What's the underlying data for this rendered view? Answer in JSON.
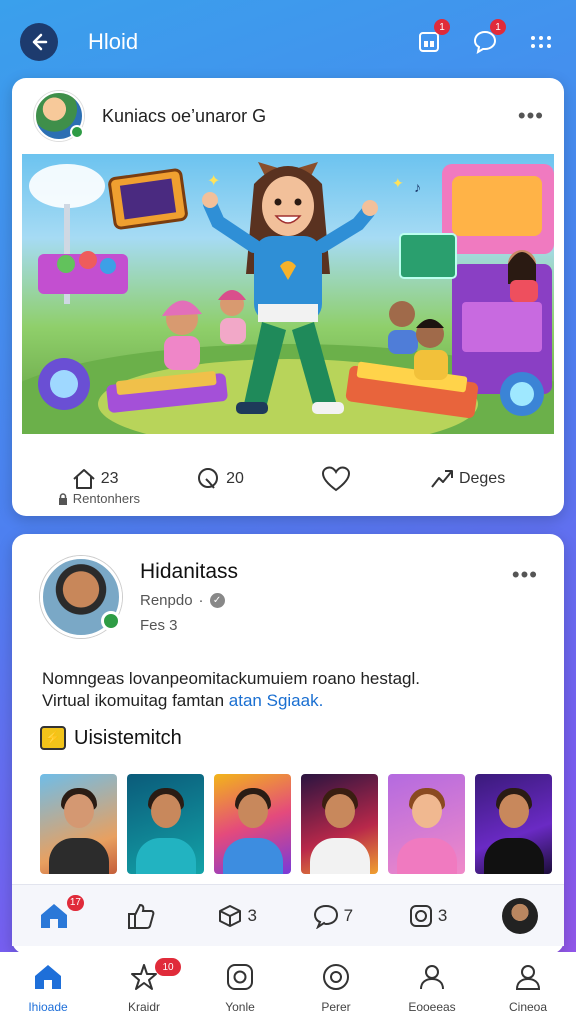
{
  "header": {
    "title": "Hloid",
    "back_icon": "arrow-left-icon",
    "notif_badge": "1",
    "message_badge": "1"
  },
  "feed_post": {
    "author": "Kuniacs oe’unaror G",
    "image_alt": "Animated scene of a cheerful cartoon girl dancing among kids playing games",
    "reactions": {
      "likes_count": "23",
      "likes_sub": "Rentonhers",
      "comments_count": "20",
      "share_label": "Deges"
    }
  },
  "profile_post": {
    "name": "Hidanitass",
    "subtitle": "Renpdo",
    "subtitle2": "Fes 3",
    "text_line1": "Nomngeas lovanpeomitackumuiem roano hestagl.",
    "text_line2_plain": "Virtual ikomuitag famtan",
    "text_line2_link": "atan Sgiaak.",
    "section_title": "Uisistemitch"
  },
  "action_bar": {
    "home_badge": "17",
    "share_count": "",
    "games_count": "3",
    "comments_count": "7",
    "camera_count": "3"
  },
  "bottom_nav": {
    "items": [
      {
        "label": "Ihioade",
        "icon": "home-icon"
      },
      {
        "label": "Kraidr",
        "icon": "sparkle-icon",
        "badge": "10"
      },
      {
        "label": "Yonle",
        "icon": "instagram-icon"
      },
      {
        "label": "Perer",
        "icon": "record-icon"
      },
      {
        "label": "Eooeeas",
        "icon": "user-icon"
      },
      {
        "label": "Cineoa",
        "icon": "profile-icon"
      }
    ]
  },
  "colors": {
    "accent": "#1e6fd9",
    "badge": "#e02b3a",
    "status_online": "#2e9c45"
  }
}
